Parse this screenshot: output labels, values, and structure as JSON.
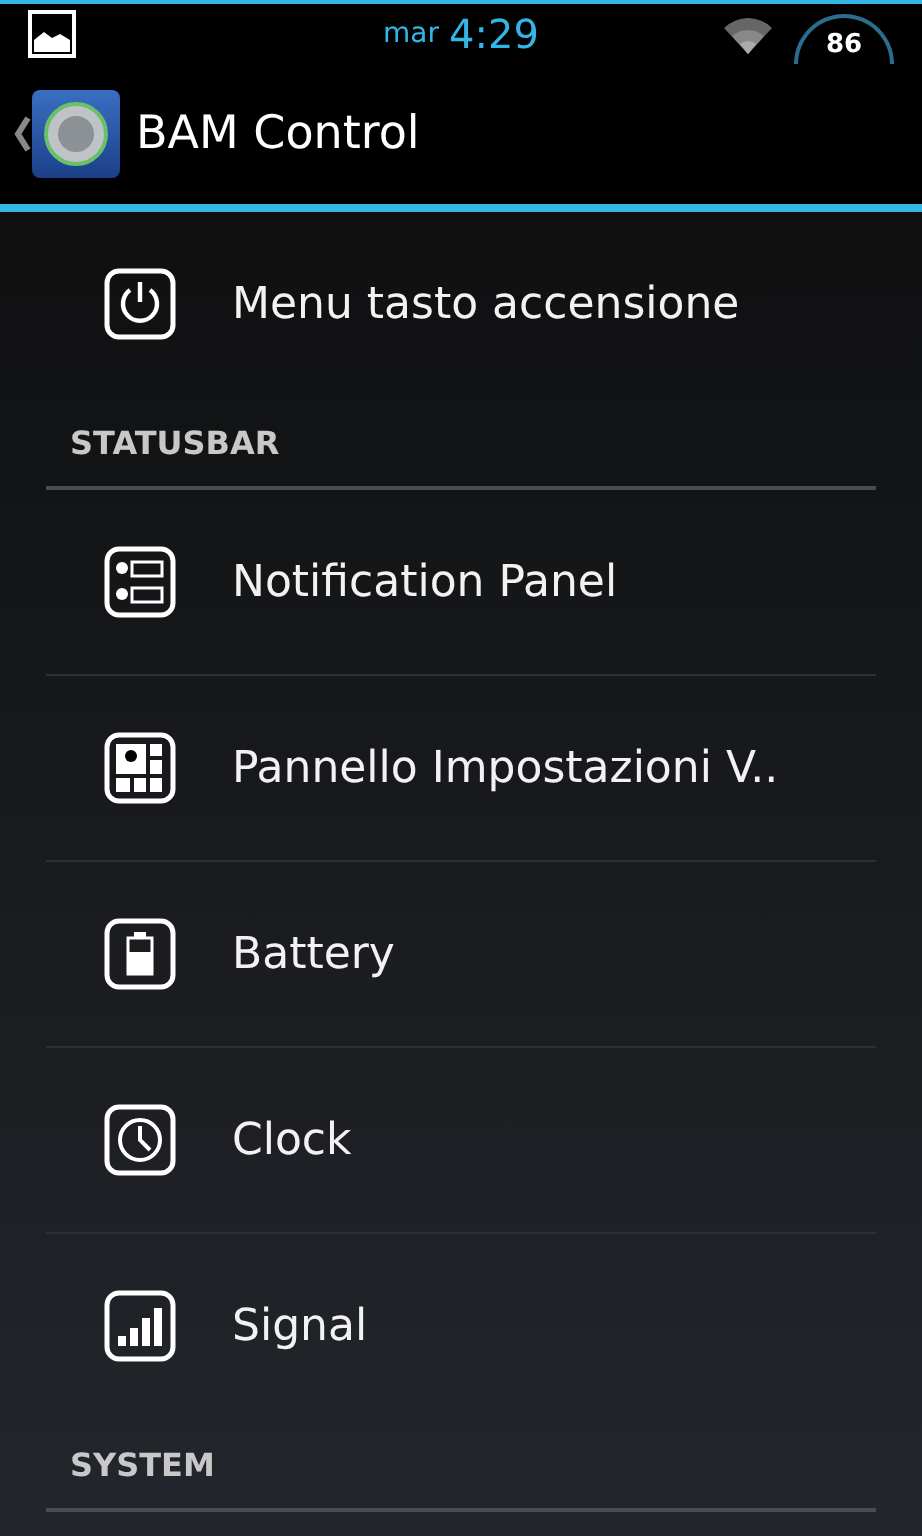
{
  "status_bar": {
    "day": "mar",
    "time": "4:29",
    "battery": "86"
  },
  "action_bar": {
    "title": "BAM Control"
  },
  "entries": [
    {
      "kind": "item",
      "label": "Menu tasto accensione"
    },
    {
      "kind": "header",
      "label": "STATUSBAR"
    },
    {
      "kind": "item",
      "label": "Notification Panel"
    },
    {
      "kind": "item",
      "label": "Pannello Impostazioni V.."
    },
    {
      "kind": "item",
      "label": "Battery"
    },
    {
      "kind": "item",
      "label": "Clock"
    },
    {
      "kind": "item",
      "label": "Signal"
    },
    {
      "kind": "header",
      "label": "SYSTEM"
    }
  ]
}
